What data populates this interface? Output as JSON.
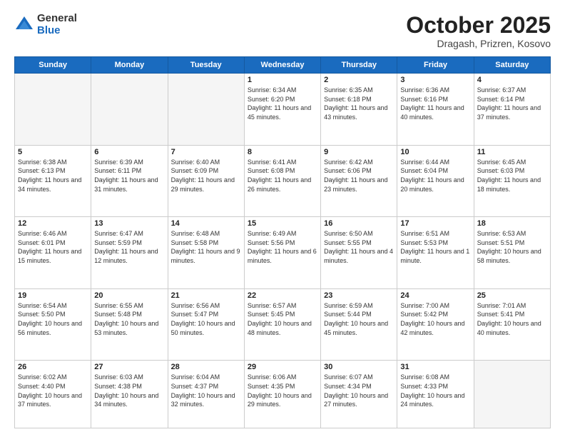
{
  "logo": {
    "general": "General",
    "blue": "Blue"
  },
  "title": {
    "month": "October 2025",
    "location": "Dragash, Prizren, Kosovo"
  },
  "days_header": [
    "Sunday",
    "Monday",
    "Tuesday",
    "Wednesday",
    "Thursday",
    "Friday",
    "Saturday"
  ],
  "weeks": [
    [
      {
        "day": "",
        "text": ""
      },
      {
        "day": "",
        "text": ""
      },
      {
        "day": "",
        "text": ""
      },
      {
        "day": "1",
        "text": "Sunrise: 6:34 AM\nSunset: 6:20 PM\nDaylight: 11 hours and 45 minutes."
      },
      {
        "day": "2",
        "text": "Sunrise: 6:35 AM\nSunset: 6:18 PM\nDaylight: 11 hours and 43 minutes."
      },
      {
        "day": "3",
        "text": "Sunrise: 6:36 AM\nSunset: 6:16 PM\nDaylight: 11 hours and 40 minutes."
      },
      {
        "day": "4",
        "text": "Sunrise: 6:37 AM\nSunset: 6:14 PM\nDaylight: 11 hours and 37 minutes."
      }
    ],
    [
      {
        "day": "5",
        "text": "Sunrise: 6:38 AM\nSunset: 6:13 PM\nDaylight: 11 hours and 34 minutes."
      },
      {
        "day": "6",
        "text": "Sunrise: 6:39 AM\nSunset: 6:11 PM\nDaylight: 11 hours and 31 minutes."
      },
      {
        "day": "7",
        "text": "Sunrise: 6:40 AM\nSunset: 6:09 PM\nDaylight: 11 hours and 29 minutes."
      },
      {
        "day": "8",
        "text": "Sunrise: 6:41 AM\nSunset: 6:08 PM\nDaylight: 11 hours and 26 minutes."
      },
      {
        "day": "9",
        "text": "Sunrise: 6:42 AM\nSunset: 6:06 PM\nDaylight: 11 hours and 23 minutes."
      },
      {
        "day": "10",
        "text": "Sunrise: 6:44 AM\nSunset: 6:04 PM\nDaylight: 11 hours and 20 minutes."
      },
      {
        "day": "11",
        "text": "Sunrise: 6:45 AM\nSunset: 6:03 PM\nDaylight: 11 hours and 18 minutes."
      }
    ],
    [
      {
        "day": "12",
        "text": "Sunrise: 6:46 AM\nSunset: 6:01 PM\nDaylight: 11 hours and 15 minutes."
      },
      {
        "day": "13",
        "text": "Sunrise: 6:47 AM\nSunset: 5:59 PM\nDaylight: 11 hours and 12 minutes."
      },
      {
        "day": "14",
        "text": "Sunrise: 6:48 AM\nSunset: 5:58 PM\nDaylight: 11 hours and 9 minutes."
      },
      {
        "day": "15",
        "text": "Sunrise: 6:49 AM\nSunset: 5:56 PM\nDaylight: 11 hours and 6 minutes."
      },
      {
        "day": "16",
        "text": "Sunrise: 6:50 AM\nSunset: 5:55 PM\nDaylight: 11 hours and 4 minutes."
      },
      {
        "day": "17",
        "text": "Sunrise: 6:51 AM\nSunset: 5:53 PM\nDaylight: 11 hours and 1 minute."
      },
      {
        "day": "18",
        "text": "Sunrise: 6:53 AM\nSunset: 5:51 PM\nDaylight: 10 hours and 58 minutes."
      }
    ],
    [
      {
        "day": "19",
        "text": "Sunrise: 6:54 AM\nSunset: 5:50 PM\nDaylight: 10 hours and 56 minutes."
      },
      {
        "day": "20",
        "text": "Sunrise: 6:55 AM\nSunset: 5:48 PM\nDaylight: 10 hours and 53 minutes."
      },
      {
        "day": "21",
        "text": "Sunrise: 6:56 AM\nSunset: 5:47 PM\nDaylight: 10 hours and 50 minutes."
      },
      {
        "day": "22",
        "text": "Sunrise: 6:57 AM\nSunset: 5:45 PM\nDaylight: 10 hours and 48 minutes."
      },
      {
        "day": "23",
        "text": "Sunrise: 6:59 AM\nSunset: 5:44 PM\nDaylight: 10 hours and 45 minutes."
      },
      {
        "day": "24",
        "text": "Sunrise: 7:00 AM\nSunset: 5:42 PM\nDaylight: 10 hours and 42 minutes."
      },
      {
        "day": "25",
        "text": "Sunrise: 7:01 AM\nSunset: 5:41 PM\nDaylight: 10 hours and 40 minutes."
      }
    ],
    [
      {
        "day": "26",
        "text": "Sunrise: 6:02 AM\nSunset: 4:40 PM\nDaylight: 10 hours and 37 minutes."
      },
      {
        "day": "27",
        "text": "Sunrise: 6:03 AM\nSunset: 4:38 PM\nDaylight: 10 hours and 34 minutes."
      },
      {
        "day": "28",
        "text": "Sunrise: 6:04 AM\nSunset: 4:37 PM\nDaylight: 10 hours and 32 minutes."
      },
      {
        "day": "29",
        "text": "Sunrise: 6:06 AM\nSunset: 4:35 PM\nDaylight: 10 hours and 29 minutes."
      },
      {
        "day": "30",
        "text": "Sunrise: 6:07 AM\nSunset: 4:34 PM\nDaylight: 10 hours and 27 minutes."
      },
      {
        "day": "31",
        "text": "Sunrise: 6:08 AM\nSunset: 4:33 PM\nDaylight: 10 hours and 24 minutes."
      },
      {
        "day": "",
        "text": ""
      }
    ]
  ]
}
